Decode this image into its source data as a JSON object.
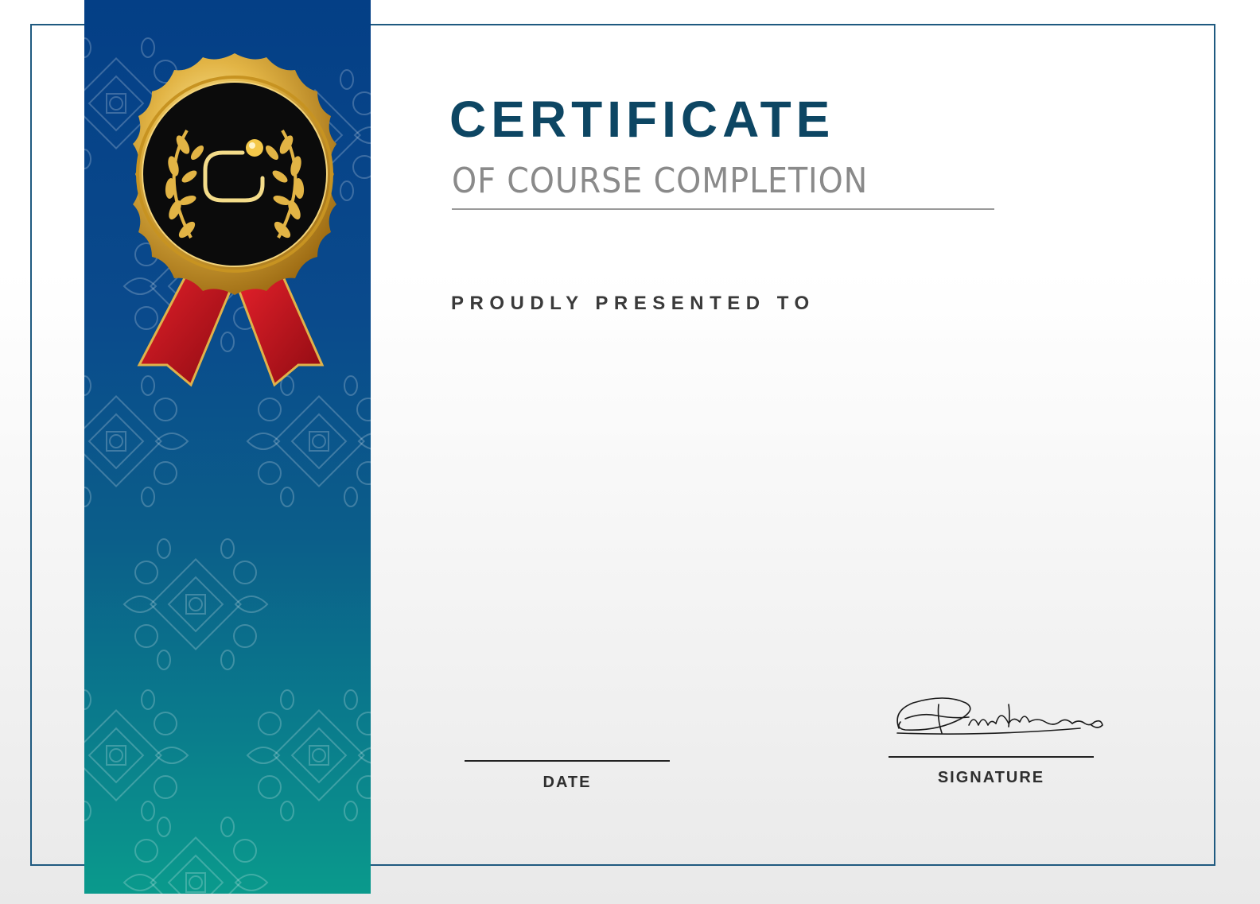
{
  "certificate": {
    "title": "CERTIFICATE",
    "subtitle": "OF COURSE COMPLETION",
    "presented_to": "PROUDLY PRESENTED TO",
    "recipient_name": "",
    "date_label": "DATE",
    "date_value": "",
    "signature_label": "SIGNATURE"
  },
  "colors": {
    "title": "#0d4663",
    "ribbon_top": "#043f86",
    "ribbon_bottom": "#0a9a8c",
    "frame_border": "#1f5a80",
    "medal_gold": "#d9a93a",
    "medal_center": "#111111",
    "medal_ribbon_red": "#c0141c"
  },
  "icons": {
    "medal": "award-medal-icon",
    "laurel": "laurel-wreath-icon",
    "signature": "handwritten-signature"
  }
}
